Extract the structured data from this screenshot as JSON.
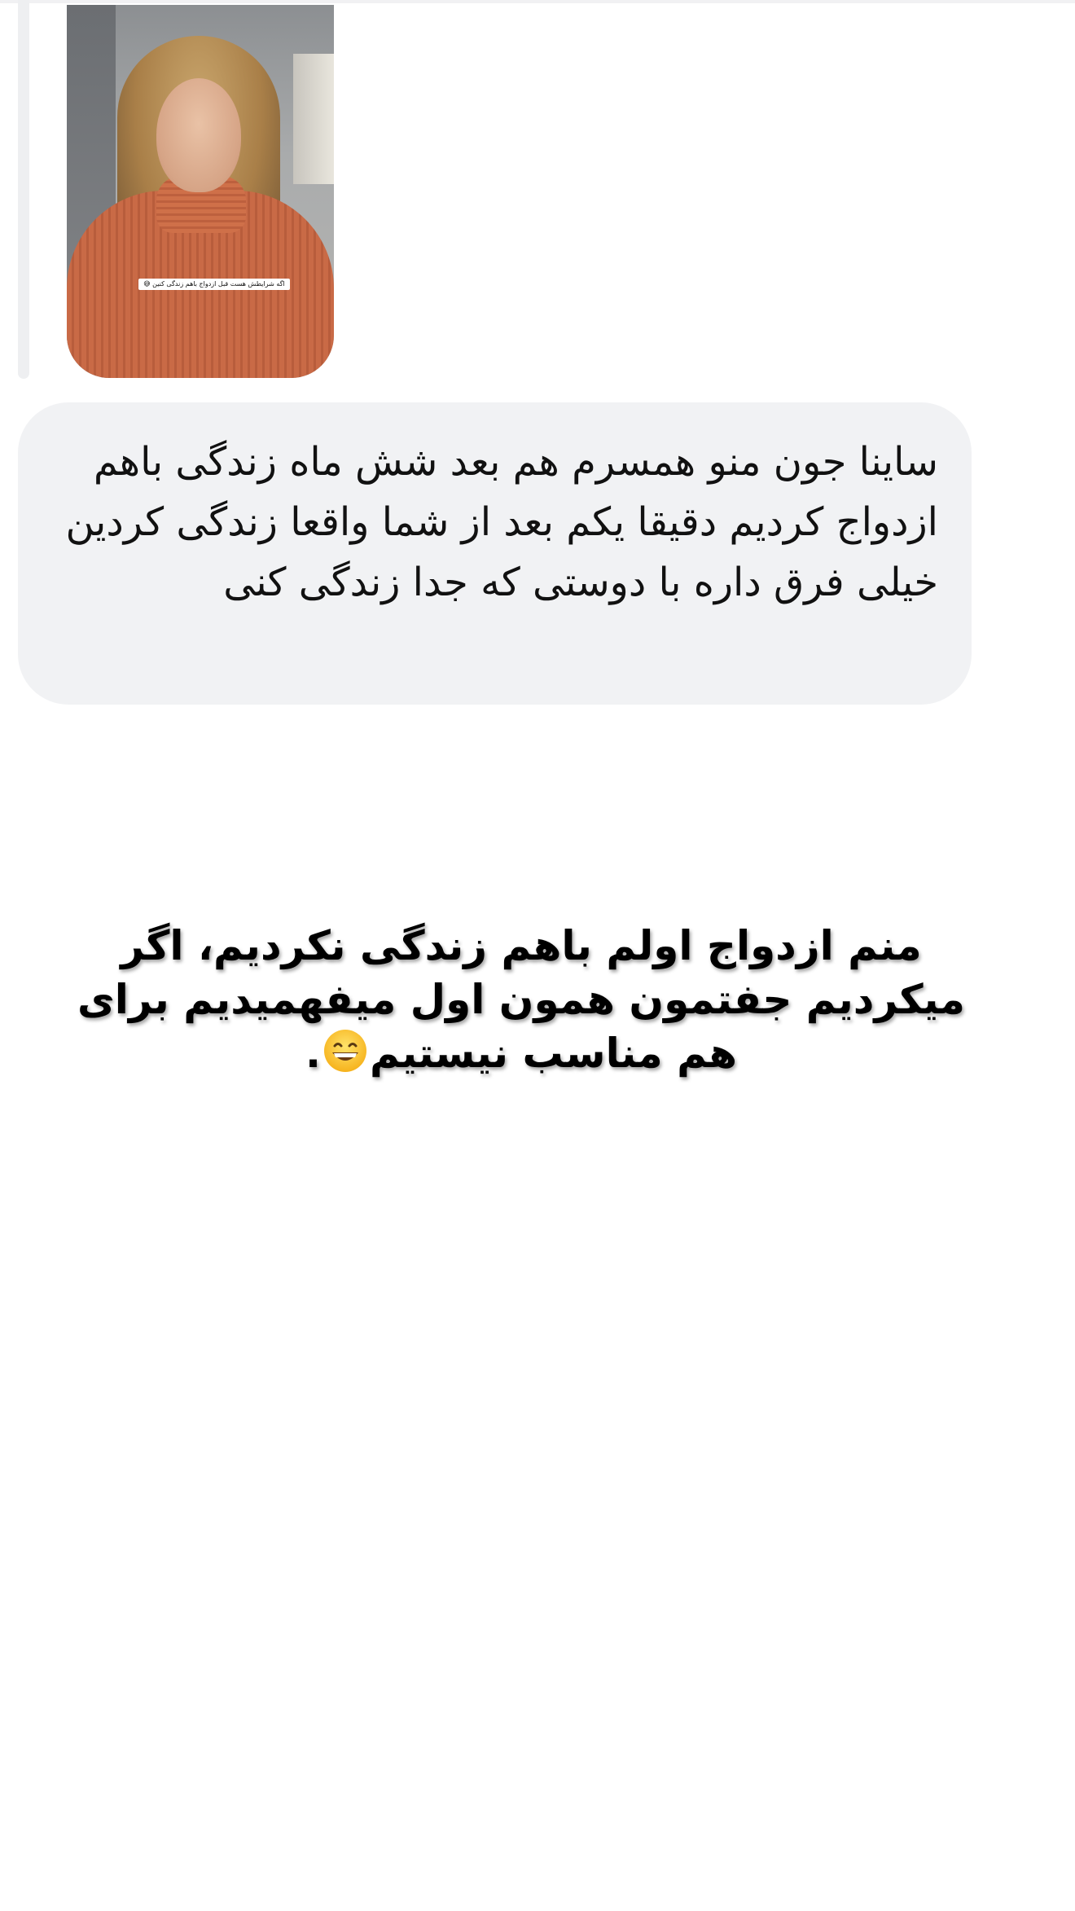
{
  "story_reply": {
    "thumbnail_caption": "اگه شرایطش هست قبل ازدواج باهم زندگی کنین 😅"
  },
  "message": {
    "text": "ساینا جون منو همسرم هم بعد شش ماه زندگی باهم ازدواج کردیم دقیقا یکم بعد از شما واقعا زندگی کردین خیلی فرق داره با دوستی که جدا زندگی کنی"
  },
  "overlay": {
    "text_main": "منم ازدواج اولم باهم زندگی نکردیم، اگر میکردیم جفتمون همون اول میفهمیدیم برای  هم مناسب نیستیم",
    "emoji_icon": "grinning-face-icon",
    "text_end": "."
  },
  "colors": {
    "bubble_background": "#f1f2f4",
    "reply_bar": "#eeeff1",
    "text": "#111111"
  }
}
